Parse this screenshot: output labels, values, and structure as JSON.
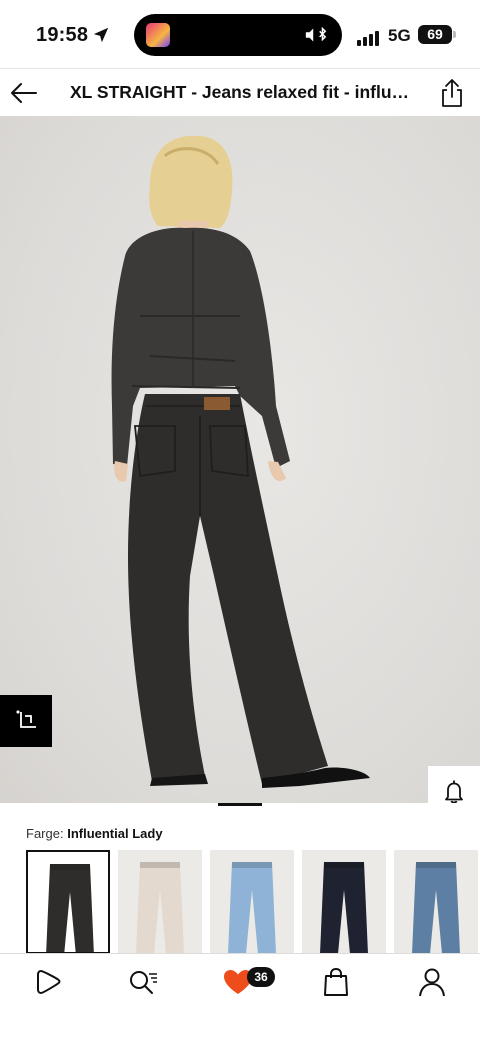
{
  "status_bar": {
    "time": "19:58",
    "network": "5G",
    "battery": "69",
    "icons": [
      "location-arrow-icon",
      "album-art-icon",
      "mute-icon",
      "bluetooth-icon",
      "signal-icon"
    ]
  },
  "header": {
    "title": "XL STRAIGHT - Jeans relaxed fit - influential lady",
    "back_icon": "back-arrow-icon",
    "share_icon": "share-icon"
  },
  "product_image": {
    "description_icon": "product-photo",
    "actions": [
      "bell-icon",
      "heart-icon",
      "shopping-bag-icon"
    ],
    "crop_icon": "crop-icon",
    "gallery_position": 0.5
  },
  "color": {
    "label": "Farge:",
    "selected_name": "Influential Lady",
    "swatches": [
      {
        "name": "influential-lady",
        "color": "#2f2d2c",
        "selected": true
      },
      {
        "name": "ecru",
        "color": "#e4d9cf",
        "selected": false
      },
      {
        "name": "light-blue",
        "color": "#8fb3d6",
        "selected": false
      },
      {
        "name": "dark-rinse",
        "color": "#1f2230",
        "selected": false
      },
      {
        "name": "mid-blue",
        "color": "#5d7fa3",
        "selected": false
      }
    ]
  },
  "bottom_nav": {
    "items": [
      "home-icon",
      "search-icon",
      "favorites-icon",
      "bag-icon",
      "profile-icon"
    ],
    "favorites_count": "36",
    "accent": "#ee4c1b"
  }
}
